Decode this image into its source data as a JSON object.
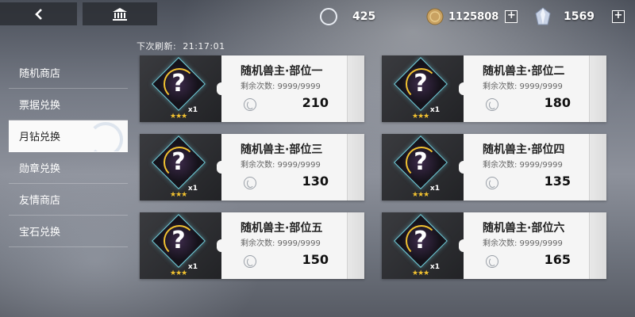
{
  "header": {
    "resources": [
      {
        "name": "moon-diamond",
        "value": "425",
        "has_plus": false
      },
      {
        "name": "gold-coin",
        "value": "1125808",
        "has_plus": true
      },
      {
        "name": "crystal",
        "value": "1569",
        "has_plus": true
      }
    ],
    "plus_label": "+"
  },
  "refresh": {
    "label": "下次刷新:",
    "time": "21:17:01"
  },
  "sidebar": {
    "items": [
      {
        "label": "随机商店",
        "active": false
      },
      {
        "label": "票据兑换",
        "active": false
      },
      {
        "label": "月钻兑换",
        "active": true
      },
      {
        "label": "勋章兑换",
        "active": false
      },
      {
        "label": "友情商店",
        "active": false
      },
      {
        "label": "宝石兑换",
        "active": false
      }
    ]
  },
  "cards": [
    {
      "name": "随机兽主·部位一",
      "remain": "剩余次数: 9999/9999",
      "price": "210",
      "count": "x1",
      "stars": "★★★"
    },
    {
      "name": "随机兽主·部位二",
      "remain": "剩余次数: 9999/9999",
      "price": "180",
      "count": "x1",
      "stars": "★★★"
    },
    {
      "name": "随机兽主·部位三",
      "remain": "剩余次数: 9999/9999",
      "price": "130",
      "count": "x1",
      "stars": "★★★"
    },
    {
      "name": "随机兽主·部位四",
      "remain": "剩余次数: 9999/9999",
      "price": "135",
      "count": "x1",
      "stars": "★★★"
    },
    {
      "name": "随机兽主·部位五",
      "remain": "剩余次数: 9999/9999",
      "price": "150",
      "count": "x1",
      "stars": "★★★"
    },
    {
      "name": "随机兽主·部位六",
      "remain": "剩余次数: 9999/9999",
      "price": "165",
      "count": "x1",
      "stars": "★★★"
    }
  ],
  "colors": {
    "accent_gold": "#f2c230",
    "accent_cyan": "#6ec9d6",
    "card_bg": "#f5f5f5"
  }
}
